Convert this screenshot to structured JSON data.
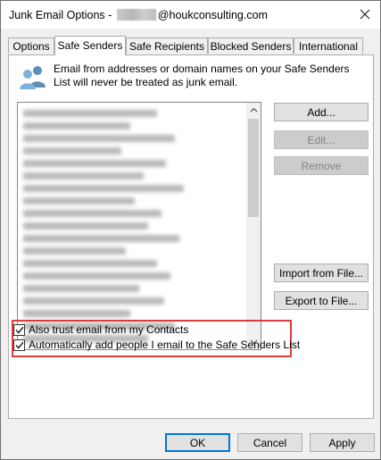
{
  "window": {
    "title_prefix": "Junk Email Options - ",
    "title_domain": "@houkconsulting.com",
    "close_glyph": "✕"
  },
  "tabs": [
    {
      "label": "Options"
    },
    {
      "label": "Safe Senders"
    },
    {
      "label": "Safe Recipients"
    },
    {
      "label": "Blocked Senders"
    },
    {
      "label": "International"
    }
  ],
  "active_tab": "Safe Senders",
  "panel": {
    "description": "Email from addresses or domain names on your Safe Senders List will never be treated as junk email.",
    "icon": "people-icon"
  },
  "buttons": {
    "add": "Add...",
    "edit": "Edit...",
    "remove": "Remove",
    "import": "Import from File...",
    "export": "Export to File..."
  },
  "checkboxes": [
    {
      "label": "Also trust email from my Contacts",
      "checked": true
    },
    {
      "label": "Automatically add people I email to the Safe Senders List",
      "checked": true
    }
  ],
  "footer": {
    "ok": "OK",
    "cancel": "Cancel",
    "apply": "Apply"
  },
  "colors": {
    "highlight_border": "#e0393e",
    "default_button_border": "#0078d7"
  }
}
